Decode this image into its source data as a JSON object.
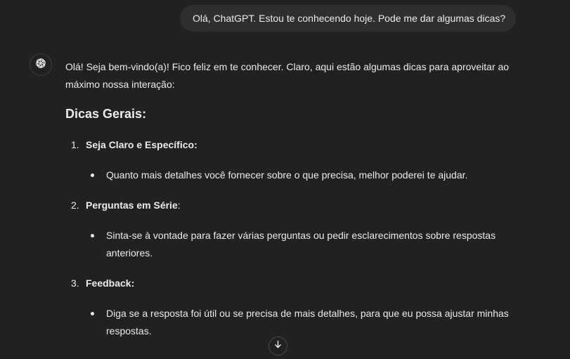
{
  "user_message": "Olá, ChatGPT. Estou te conhecendo hoje. Pode me dar algumas dicas?",
  "assistant": {
    "avatar_icon": "openai-logo-icon",
    "intro": "Olá! Seja bem-vindo(a)! Fico feliz em te conhecer. Claro, aqui estão algumas dicas para aproveitar ao máximo nossa interação:",
    "heading": "Dicas Gerais:",
    "tips": [
      {
        "number": "1.",
        "title": "Seja Claro e Específico",
        "suffix": ":",
        "body": "Quanto mais detalhes você fornecer sobre o que precisa, melhor poderei te ajudar."
      },
      {
        "number": "2.",
        "title": "Perguntas em Série",
        "suffix": ":",
        "body": "Sinta-se à vontade para fazer várias perguntas ou pedir esclarecimentos sobre respostas anteriores."
      },
      {
        "number": "3.",
        "title": "Feedback",
        "suffix": ":",
        "body": "Diga se a resposta foi útil ou se precisa de mais detalhes, para que eu possa ajustar minhas respostas."
      }
    ]
  },
  "scroll_button_icon": "arrow-down-icon",
  "colors": {
    "background": "#212121",
    "bubble": "#2f2f2f",
    "text": "#ececec"
  }
}
